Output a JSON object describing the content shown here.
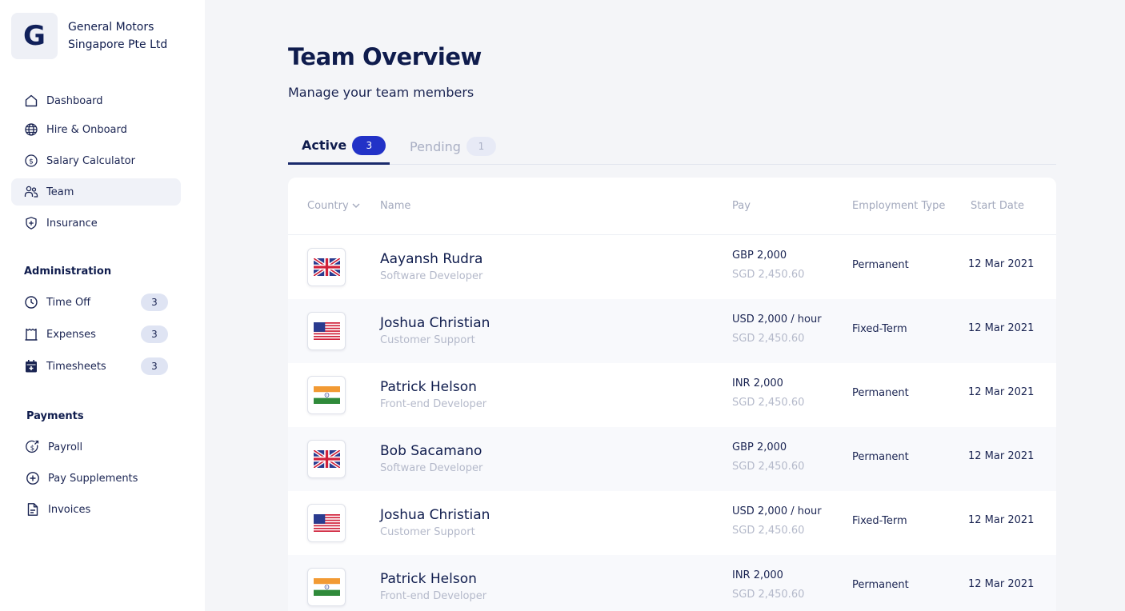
{
  "company": {
    "initial": "G",
    "name": "General Motors Singapore Pte Ltd"
  },
  "nav": {
    "main": [
      {
        "label": "Dashboard",
        "icon": "home-icon"
      },
      {
        "label": "Hire & Onboard",
        "icon": "globe-icon"
      },
      {
        "label": "Salary Calculator",
        "icon": "dollar-circle-icon"
      },
      {
        "label": "Team",
        "icon": "users-icon",
        "active": true
      },
      {
        "label": "Insurance",
        "icon": "shield-icon"
      }
    ],
    "administration_title": "Administration",
    "administration": [
      {
        "label": "Time Off",
        "icon": "clock-icon",
        "badge": "3"
      },
      {
        "label": "Expenses",
        "icon": "receipt-icon",
        "badge": "3"
      },
      {
        "label": "Timesheets",
        "icon": "calendar-icon",
        "badge": "3"
      }
    ],
    "payments_title": "Payments",
    "payments": [
      {
        "label": "Payroll",
        "icon": "payroll-icon"
      },
      {
        "label": "Pay Supplements",
        "icon": "plus-circle-icon"
      },
      {
        "label": "Invoices",
        "icon": "document-icon"
      }
    ]
  },
  "page": {
    "title": "Team Overview",
    "subtitle": "Manage your team members"
  },
  "tabs": {
    "active": {
      "label": "Active",
      "count": "3"
    },
    "pending": {
      "label": "Pending",
      "count": "1"
    }
  },
  "table": {
    "headers": {
      "country": "Country",
      "name": "Name",
      "pay": "Pay",
      "employment": "Employment Type",
      "start": "Start Date"
    },
    "rows": [
      {
        "flag": "uk-flag-icon",
        "name": "Aayansh Rudra",
        "role": "Software Developer",
        "pay": "GBP 2,000",
        "pay_sgd": "SGD 2,450.60",
        "type": "Permanent",
        "date": "12 Mar 2021"
      },
      {
        "flag": "us-flag-icon",
        "name": "Joshua Christian",
        "role": "Customer Support",
        "pay": "USD 2,000 / hour",
        "pay_sgd": "SGD 2,450.60",
        "type": "Fixed-Term",
        "date": "12 Mar 2021"
      },
      {
        "flag": "india-flag-icon",
        "name": "Patrick Helson",
        "role": "Front-end Developer",
        "pay": "INR 2,000",
        "pay_sgd": "SGD 2,450.60",
        "type": "Permanent",
        "date": "12 Mar 2021"
      },
      {
        "flag": "uk-flag-icon",
        "name": "Bob Sacamano",
        "role": "Software Developer",
        "pay": "GBP 2,000",
        "pay_sgd": "SGD 2,450.60",
        "type": "Permanent",
        "date": "12 Mar 2021"
      },
      {
        "flag": "us-flag-icon",
        "name": "Joshua Christian",
        "role": "Customer Support",
        "pay": "USD 2,000 / hour",
        "pay_sgd": "SGD 2,450.60",
        "type": "Fixed-Term",
        "date": "12 Mar 2021"
      },
      {
        "flag": "india-flag-icon",
        "name": "Patrick Helson",
        "role": "Front-end Developer",
        "pay": "INR 2,000",
        "pay_sgd": "SGD 2,450.60",
        "type": "Permanent",
        "date": "12 Mar 2021"
      }
    ]
  },
  "colors": {
    "accent": "#2232c7",
    "navy": "#0f1c4d",
    "muted": "#a3a9bd",
    "background": "#f4f5f8"
  }
}
